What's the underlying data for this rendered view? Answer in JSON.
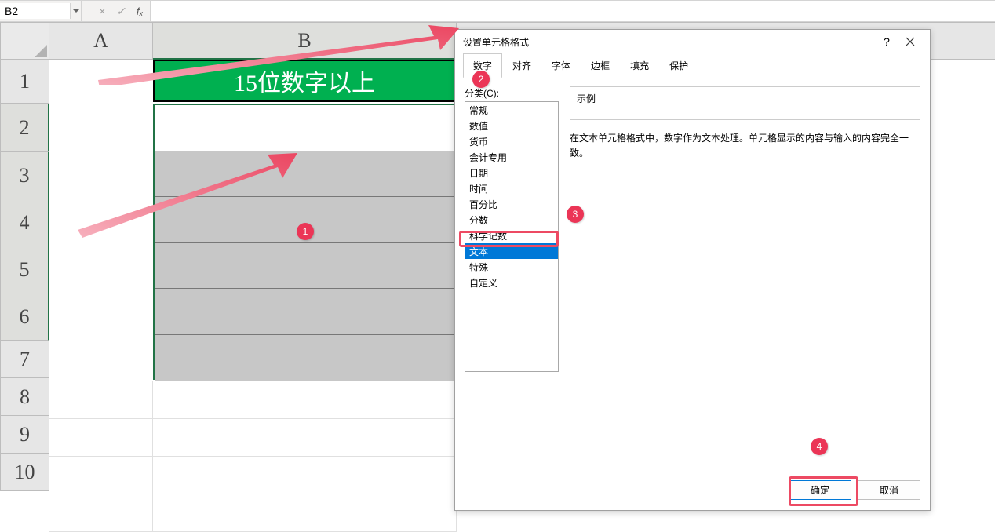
{
  "name_box": {
    "value": "B2"
  },
  "formula_bar": {
    "cancel_symbol": "×",
    "confirm_symbol": "✓",
    "fn_symbol": "fₓ"
  },
  "columns": {
    "A": "A",
    "B": "B"
  },
  "rows": [
    "1",
    "2",
    "3",
    "4",
    "5",
    "6",
    "7",
    "8",
    "9",
    "10"
  ],
  "cell_B1": "15位数字以上",
  "dialog": {
    "title": "设置单元格格式",
    "help": "?",
    "tabs": [
      "数字",
      "对齐",
      "字体",
      "边框",
      "填充",
      "保护"
    ],
    "category_label": "分类(C):",
    "categories": [
      "常规",
      "数值",
      "货币",
      "会计专用",
      "日期",
      "时间",
      "百分比",
      "分数",
      "科学记数",
      "文本",
      "特殊",
      "自定义"
    ],
    "selected_category_index": 9,
    "sample_label": "示例",
    "description": "在文本单元格格式中，数字作为文本处理。单元格显示的内容与输入的内容完全一致。",
    "ok": "确定",
    "cancel": "取消"
  },
  "badges": [
    "1",
    "2",
    "3",
    "4"
  ]
}
